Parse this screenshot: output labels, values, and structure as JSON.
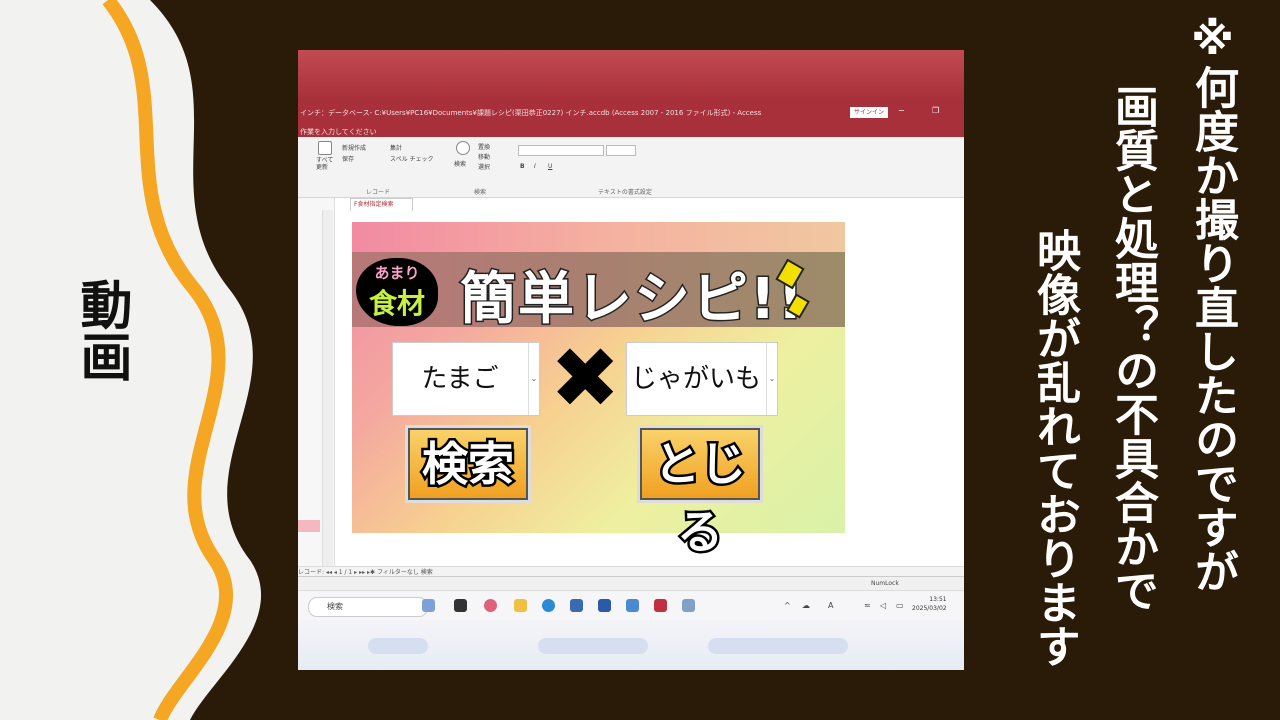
{
  "left_label": "動画",
  "caption": {
    "col1": "※何度か撮り直したのですが",
    "col2": "画質と処理？の不具合かで",
    "col3": "映像が乱れております"
  },
  "access": {
    "title": "インチ：データベース- C:¥Users¥PC16¥Documents¥課題レシピ(栗田恭正0227) インチ.accdb (Access 2007 - 2016 ファイル形式) - Access",
    "signin": "サインイン",
    "tellme": "作業を入力してください",
    "ribbon": {
      "all_update": "すべて更新",
      "new": "新規作成",
      "save": "保存",
      "sum": "集計",
      "spell": "スペル チェック",
      "group_record": "レコード",
      "search_btn": "検索",
      "replace": "置換",
      "move": "移動",
      "select": "選択",
      "group_search": "検索",
      "group_text": "テキストの書式設定",
      "font_b": "B",
      "font_i": "I",
      "font_u": "U"
    },
    "doc_tab": "F食材指定検索",
    "form": {
      "badge_small": "あまり",
      "badge_big": "食材",
      "title": "簡単レシピ!!",
      "combo1": "たまご",
      "cross": "✖",
      "combo2": "じゃがいも",
      "search_button": "検索",
      "close_button": "とじる"
    },
    "record_nav": "レコード: ◂◂ ◂ 1 / 1 ▸ ▸▸ ▸✱  フィルターなし   検索",
    "status": "NumLock",
    "taskbar": {
      "search": "検索",
      "time": "13:51",
      "date": "2025/03/02"
    }
  },
  "colors": {
    "background": "#2a1a08",
    "left_panel": "#f2f2f0",
    "wave": "#f5a623",
    "access_red": "#a8303a"
  }
}
